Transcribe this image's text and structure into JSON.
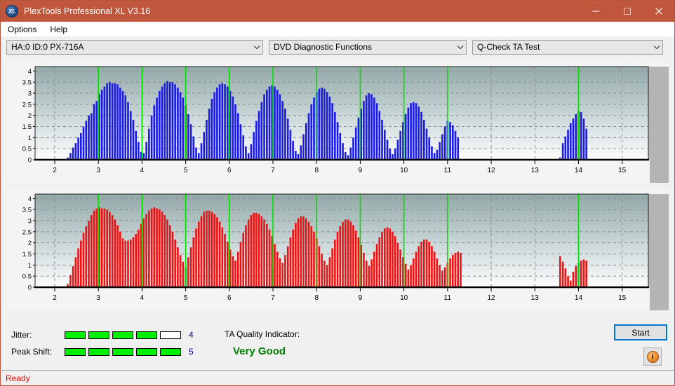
{
  "window": {
    "title": "PlexTools Professional XL V3.16",
    "icon": "XL",
    "icon_name": "plextools-xl-icon",
    "controls": {
      "minimize": "minimize-icon",
      "maximize": "maximize-icon",
      "close": "close-icon"
    },
    "titlebar_color": "#c0563c"
  },
  "menu": {
    "items": [
      {
        "label": "Options"
      },
      {
        "label": "Help"
      }
    ]
  },
  "toolbar": {
    "drive_select": {
      "value": "HA:0 ID:0  PX-716A",
      "icon": "chevron-down-icon"
    },
    "function_select": {
      "value": "DVD Diagnostic Functions",
      "icon": "chevron-down-icon"
    },
    "test_select": {
      "value": "Q-Check TA Test",
      "icon": "chevron-down-icon"
    }
  },
  "chart_data": [
    {
      "type": "bar",
      "name": "ta-chart-top",
      "title": "",
      "color": "#1a1ae6",
      "marker_color": "#00e000",
      "xlabel": "",
      "ylabel": "",
      "xlim": [
        1.55,
        15.6
      ],
      "ylim": [
        0,
        4.2
      ],
      "yticks": [
        0,
        0.5,
        1,
        1.5,
        2,
        2.5,
        3,
        3.5,
        4
      ],
      "ytick_labels": [
        "0",
        "0.5",
        "1",
        "1.5",
        "2",
        "2.5",
        "3",
        "3.5",
        "4"
      ],
      "xticks": [
        2,
        3,
        4,
        5,
        6,
        7,
        8,
        9,
        10,
        11,
        12,
        13,
        14,
        15
      ],
      "xtick_labels": [
        "2",
        "3",
        "4",
        "5",
        "6",
        "7",
        "8",
        "9",
        "10",
        "11",
        "12",
        "13",
        "14",
        "15"
      ],
      "grid": true,
      "markers": [
        3,
        4,
        5,
        6,
        7,
        8,
        9,
        10,
        11,
        14
      ],
      "x": [
        2.3,
        2.36,
        2.42,
        2.48,
        2.54,
        2.6,
        2.66,
        2.72,
        2.78,
        2.84,
        2.9,
        2.96,
        3.02,
        3.08,
        3.14,
        3.2,
        3.26,
        3.32,
        3.38,
        3.44,
        3.5,
        3.56,
        3.62,
        3.68,
        3.74,
        3.8,
        3.86,
        3.92,
        3.98,
        4.04,
        4.1,
        4.16,
        4.22,
        4.28,
        4.34,
        4.4,
        4.46,
        4.52,
        4.58,
        4.64,
        4.7,
        4.76,
        4.82,
        4.88,
        4.94,
        5.0,
        5.06,
        5.12,
        5.18,
        5.24,
        5.3,
        5.36,
        5.42,
        5.48,
        5.54,
        5.6,
        5.66,
        5.72,
        5.78,
        5.84,
        5.9,
        5.96,
        6.02,
        6.08,
        6.14,
        6.2,
        6.26,
        6.32,
        6.38,
        6.44,
        6.5,
        6.56,
        6.62,
        6.68,
        6.74,
        6.8,
        6.86,
        6.92,
        6.98,
        7.04,
        7.1,
        7.16,
        7.22,
        7.28,
        7.34,
        7.4,
        7.46,
        7.52,
        7.58,
        7.64,
        7.7,
        7.76,
        7.82,
        7.88,
        7.94,
        8.0,
        8.06,
        8.12,
        8.18,
        8.24,
        8.3,
        8.36,
        8.42,
        8.48,
        8.54,
        8.6,
        8.66,
        8.72,
        8.78,
        8.84,
        8.9,
        8.96,
        9.02,
        9.08,
        9.14,
        9.2,
        9.26,
        9.32,
        9.38,
        9.44,
        9.5,
        9.56,
        9.62,
        9.68,
        9.74,
        9.8,
        9.86,
        9.92,
        9.98,
        10.04,
        10.1,
        10.16,
        10.22,
        10.28,
        10.34,
        10.4,
        10.46,
        10.52,
        10.58,
        10.64,
        10.7,
        10.76,
        10.82,
        10.88,
        10.94,
        11.0,
        11.06,
        11.12,
        11.18,
        11.24,
        13.58,
        13.64,
        13.7,
        13.76,
        13.82,
        13.88,
        13.94,
        14.0,
        14.06,
        14.12,
        14.18
      ],
      "values": [
        0.1,
        0.3,
        0.55,
        0.75,
        1.0,
        1.2,
        1.5,
        1.75,
        2.0,
        2.1,
        2.5,
        2.65,
        2.95,
        3.15,
        3.3,
        3.45,
        3.5,
        3.45,
        3.45,
        3.4,
        3.25,
        3.1,
        2.9,
        2.6,
        2.2,
        1.8,
        1.3,
        0.8,
        0.35,
        0.3,
        0.8,
        1.4,
        2.0,
        2.45,
        2.8,
        3.1,
        3.3,
        3.45,
        3.55,
        3.5,
        3.5,
        3.4,
        3.25,
        3.05,
        2.8,
        2.45,
        2.05,
        1.6,
        1.05,
        0.55,
        0.3,
        0.75,
        1.25,
        1.8,
        2.3,
        2.75,
        3.05,
        3.25,
        3.4,
        3.45,
        3.4,
        3.3,
        3.1,
        2.85,
        2.5,
        2.1,
        1.6,
        1.1,
        0.6,
        0.3,
        0.7,
        1.25,
        1.75,
        2.2,
        2.6,
        2.95,
        3.15,
        3.3,
        3.35,
        3.3,
        3.15,
        2.95,
        2.65,
        2.3,
        1.85,
        1.35,
        0.85,
        0.4,
        0.25,
        0.65,
        1.15,
        1.65,
        2.1,
        2.5,
        2.8,
        3.05,
        3.2,
        3.25,
        3.2,
        3.05,
        2.85,
        2.55,
        2.15,
        1.7,
        1.2,
        0.75,
        0.35,
        0.2,
        0.55,
        1.0,
        1.45,
        1.9,
        2.3,
        2.65,
        2.9,
        3.0,
        2.95,
        2.8,
        2.55,
        2.2,
        1.8,
        1.35,
        0.9,
        0.5,
        0.25,
        0.5,
        0.9,
        1.3,
        1.7,
        2.05,
        2.35,
        2.55,
        2.6,
        2.55,
        2.4,
        2.15,
        1.8,
        1.4,
        1.0,
        0.6,
        0.3,
        0.45,
        0.8,
        1.15,
        1.5,
        1.75,
        1.7,
        1.55,
        1.3,
        1.0,
        0.1,
        0.75,
        1.05,
        1.35,
        1.65,
        1.85,
        2.05,
        2.2,
        2.15,
        1.85,
        1.4,
        0.8
      ]
    },
    {
      "type": "bar",
      "name": "ta-chart-bottom",
      "title": "",
      "color": "#ef1111",
      "marker_color": "#00e000",
      "xlabel": "",
      "ylabel": "",
      "xlim": [
        1.55,
        15.6
      ],
      "ylim": [
        0,
        4.2
      ],
      "yticks": [
        0,
        0.5,
        1,
        1.5,
        2,
        2.5,
        3,
        3.5,
        4
      ],
      "ytick_labels": [
        "0",
        "0.5",
        "1",
        "1.5",
        "2",
        "2.5",
        "3",
        "3.5",
        "4"
      ],
      "xticks": [
        2,
        3,
        4,
        5,
        6,
        7,
        8,
        9,
        10,
        11,
        12,
        13,
        14,
        15
      ],
      "xtick_labels": [
        "2",
        "3",
        "4",
        "5",
        "6",
        "7",
        "8",
        "9",
        "10",
        "11",
        "12",
        "13",
        "14",
        "15"
      ],
      "grid": true,
      "markers": [
        3,
        4,
        5,
        6,
        7,
        8,
        9,
        10,
        11,
        14
      ],
      "x": [
        2.3,
        2.36,
        2.42,
        2.48,
        2.54,
        2.6,
        2.66,
        2.72,
        2.78,
        2.84,
        2.9,
        2.96,
        3.02,
        3.08,
        3.14,
        3.2,
        3.26,
        3.32,
        3.38,
        3.44,
        3.5,
        3.56,
        3.62,
        3.68,
        3.74,
        3.8,
        3.86,
        3.92,
        3.98,
        4.04,
        4.1,
        4.16,
        4.22,
        4.28,
        4.34,
        4.4,
        4.46,
        4.52,
        4.58,
        4.64,
        4.7,
        4.76,
        4.82,
        4.88,
        4.94,
        5.0,
        5.06,
        5.12,
        5.18,
        5.24,
        5.3,
        5.36,
        5.42,
        5.48,
        5.54,
        5.6,
        5.66,
        5.72,
        5.78,
        5.84,
        5.9,
        5.96,
        6.02,
        6.08,
        6.14,
        6.2,
        6.26,
        6.32,
        6.38,
        6.44,
        6.5,
        6.56,
        6.62,
        6.68,
        6.74,
        6.8,
        6.86,
        6.92,
        6.98,
        7.04,
        7.1,
        7.16,
        7.22,
        7.28,
        7.34,
        7.4,
        7.46,
        7.52,
        7.58,
        7.64,
        7.7,
        7.76,
        7.82,
        7.88,
        7.94,
        8.0,
        8.06,
        8.12,
        8.18,
        8.24,
        8.3,
        8.36,
        8.42,
        8.48,
        8.54,
        8.6,
        8.66,
        8.72,
        8.78,
        8.84,
        8.9,
        8.96,
        9.02,
        9.08,
        9.14,
        9.2,
        9.26,
        9.32,
        9.38,
        9.44,
        9.5,
        9.56,
        9.62,
        9.68,
        9.74,
        9.8,
        9.86,
        9.92,
        9.98,
        10.04,
        10.1,
        10.16,
        10.22,
        10.28,
        10.34,
        10.4,
        10.46,
        10.52,
        10.58,
        10.64,
        10.7,
        10.76,
        10.82,
        10.88,
        10.94,
        11.0,
        11.06,
        11.12,
        11.18,
        11.24,
        11.3,
        13.58,
        13.64,
        13.7,
        13.76,
        13.82,
        13.88,
        13.94,
        14.0,
        14.06,
        14.12,
        14.18
      ],
      "values": [
        0.15,
        0.55,
        0.95,
        1.35,
        1.75,
        2.1,
        2.45,
        2.75,
        3.0,
        3.25,
        3.45,
        3.55,
        3.6,
        3.55,
        3.55,
        3.5,
        3.4,
        3.25,
        3.05,
        2.8,
        2.5,
        2.2,
        2.1,
        2.1,
        2.15,
        2.25,
        2.4,
        2.6,
        2.85,
        3.1,
        3.3,
        3.45,
        3.55,
        3.6,
        3.55,
        3.5,
        3.4,
        3.25,
        3.05,
        2.8,
        2.5,
        2.15,
        1.8,
        1.45,
        1.15,
        0.9,
        1.35,
        1.8,
        2.25,
        2.65,
        2.95,
        3.2,
        3.4,
        3.45,
        3.45,
        3.4,
        3.3,
        3.15,
        2.95,
        2.7,
        2.4,
        2.05,
        1.7,
        1.4,
        1.2,
        1.6,
        2.05,
        2.45,
        2.8,
        3.05,
        3.25,
        3.35,
        3.35,
        3.3,
        3.2,
        3.05,
        2.85,
        2.6,
        2.3,
        1.95,
        1.6,
        1.3,
        1.1,
        1.45,
        1.85,
        2.25,
        2.6,
        2.9,
        3.1,
        3.2,
        3.2,
        3.1,
        2.95,
        2.75,
        2.5,
        2.2,
        1.85,
        1.5,
        1.2,
        1.0,
        1.35,
        1.75,
        2.15,
        2.5,
        2.75,
        2.95,
        3.05,
        3.05,
        2.95,
        2.8,
        2.55,
        2.25,
        1.9,
        1.55,
        1.2,
        0.95,
        1.25,
        1.6,
        1.95,
        2.25,
        2.5,
        2.65,
        2.7,
        2.65,
        2.5,
        2.3,
        2.0,
        1.7,
        1.35,
        1.05,
        0.8,
        1.0,
        1.3,
        1.6,
        1.85,
        2.05,
        2.15,
        2.15,
        2.05,
        1.85,
        1.6,
        1.3,
        1.0,
        0.75,
        0.9,
        1.1,
        1.3,
        1.45,
        1.55,
        1.6,
        1.55,
        1.4,
        1.15,
        0.85,
        0.5,
        0.3,
        0.7,
        0.95,
        1.1,
        1.2,
        1.25,
        1.2,
        1.05,
        0.8,
        0.55,
        0.25
      ]
    }
  ],
  "indicators": {
    "jitter": {
      "label": "Jitter:",
      "filled": 4,
      "total": 5,
      "value": "4"
    },
    "peak_shift": {
      "label": "Peak Shift:",
      "filled": 5,
      "total": 5,
      "value": "5"
    },
    "ta_quality": {
      "label": "TA Quality Indicator:",
      "value": "Very Good",
      "color": "#008000"
    }
  },
  "actions": {
    "start_button": "Start",
    "info_button": "i"
  },
  "status": {
    "text": "Ready"
  }
}
